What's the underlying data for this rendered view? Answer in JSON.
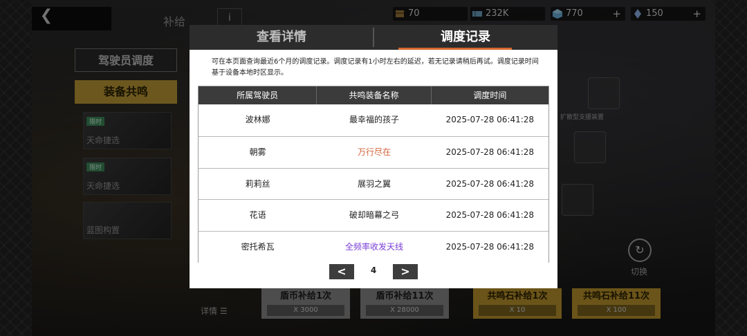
{
  "background": {
    "page_title": "补给",
    "info_label": "i",
    "currencies": [
      {
        "icon": "crate-icon",
        "value": "70",
        "plus": ""
      },
      {
        "icon": "ticket-icon",
        "value": "232K",
        "plus": ""
      },
      {
        "icon": "cube-icon",
        "value": "770",
        "plus": "+"
      },
      {
        "icon": "crystal-icon",
        "value": "150",
        "plus": "+"
      }
    ],
    "menu": {
      "dispatch": "驾驶员调度",
      "resonance": "装备共鸣"
    },
    "cards": [
      {
        "tag": "限时",
        "label": "天命捷选"
      },
      {
        "tag": "限时",
        "label": "天命捷选"
      },
      {
        "tag": "",
        "label": "蓝图构置"
      }
    ],
    "equipment_label": "扩散型支援装置",
    "switch_label": "切换",
    "details_label": "详情 ☰",
    "supply_buttons": [
      {
        "title": "盾币补给1次",
        "cost": "X 3000"
      },
      {
        "title": "盾币补给11次",
        "cost": "X 28000"
      },
      {
        "title": "共鸣石补给1次",
        "cost": "X 10"
      },
      {
        "title": "共鸣石补给11次",
        "cost": "X 100"
      }
    ]
  },
  "modal": {
    "tabs": [
      "查看详情",
      "调度记录"
    ],
    "active_tab": "调度记录",
    "notice": "可在本页面查询最近6个月的调度记录。调度记录有1小时左右的延迟，若无记录请稍后再试。调度记录时间基于设备本地时区显示。",
    "columns": [
      "所属驾驶员",
      "共鸣装备名称",
      "调度时间"
    ],
    "rows": [
      {
        "pilot": "波林娜",
        "equipment": "最幸福的孩子",
        "time": "2025-07-28 06:41:28",
        "color": "#222222"
      },
      {
        "pilot": "朝雾",
        "equipment": "万行尽在",
        "time": "2025-07-28 06:41:28",
        "color": "#d0623a"
      },
      {
        "pilot": "莉莉丝",
        "equipment": "展羽之翼",
        "time": "2025-07-28 06:41:28",
        "color": "#222222"
      },
      {
        "pilot": "花语",
        "equipment": "破却暗幕之弓",
        "time": "2025-07-28 06:41:28",
        "color": "#222222"
      },
      {
        "pilot": "密托希瓦",
        "equipment": "全频率收发天线",
        "time": "2025-07-28 06:41:28",
        "color": "#7a3fd6"
      }
    ],
    "pager": {
      "page": "4",
      "prev": "<",
      "next": ">"
    }
  }
}
